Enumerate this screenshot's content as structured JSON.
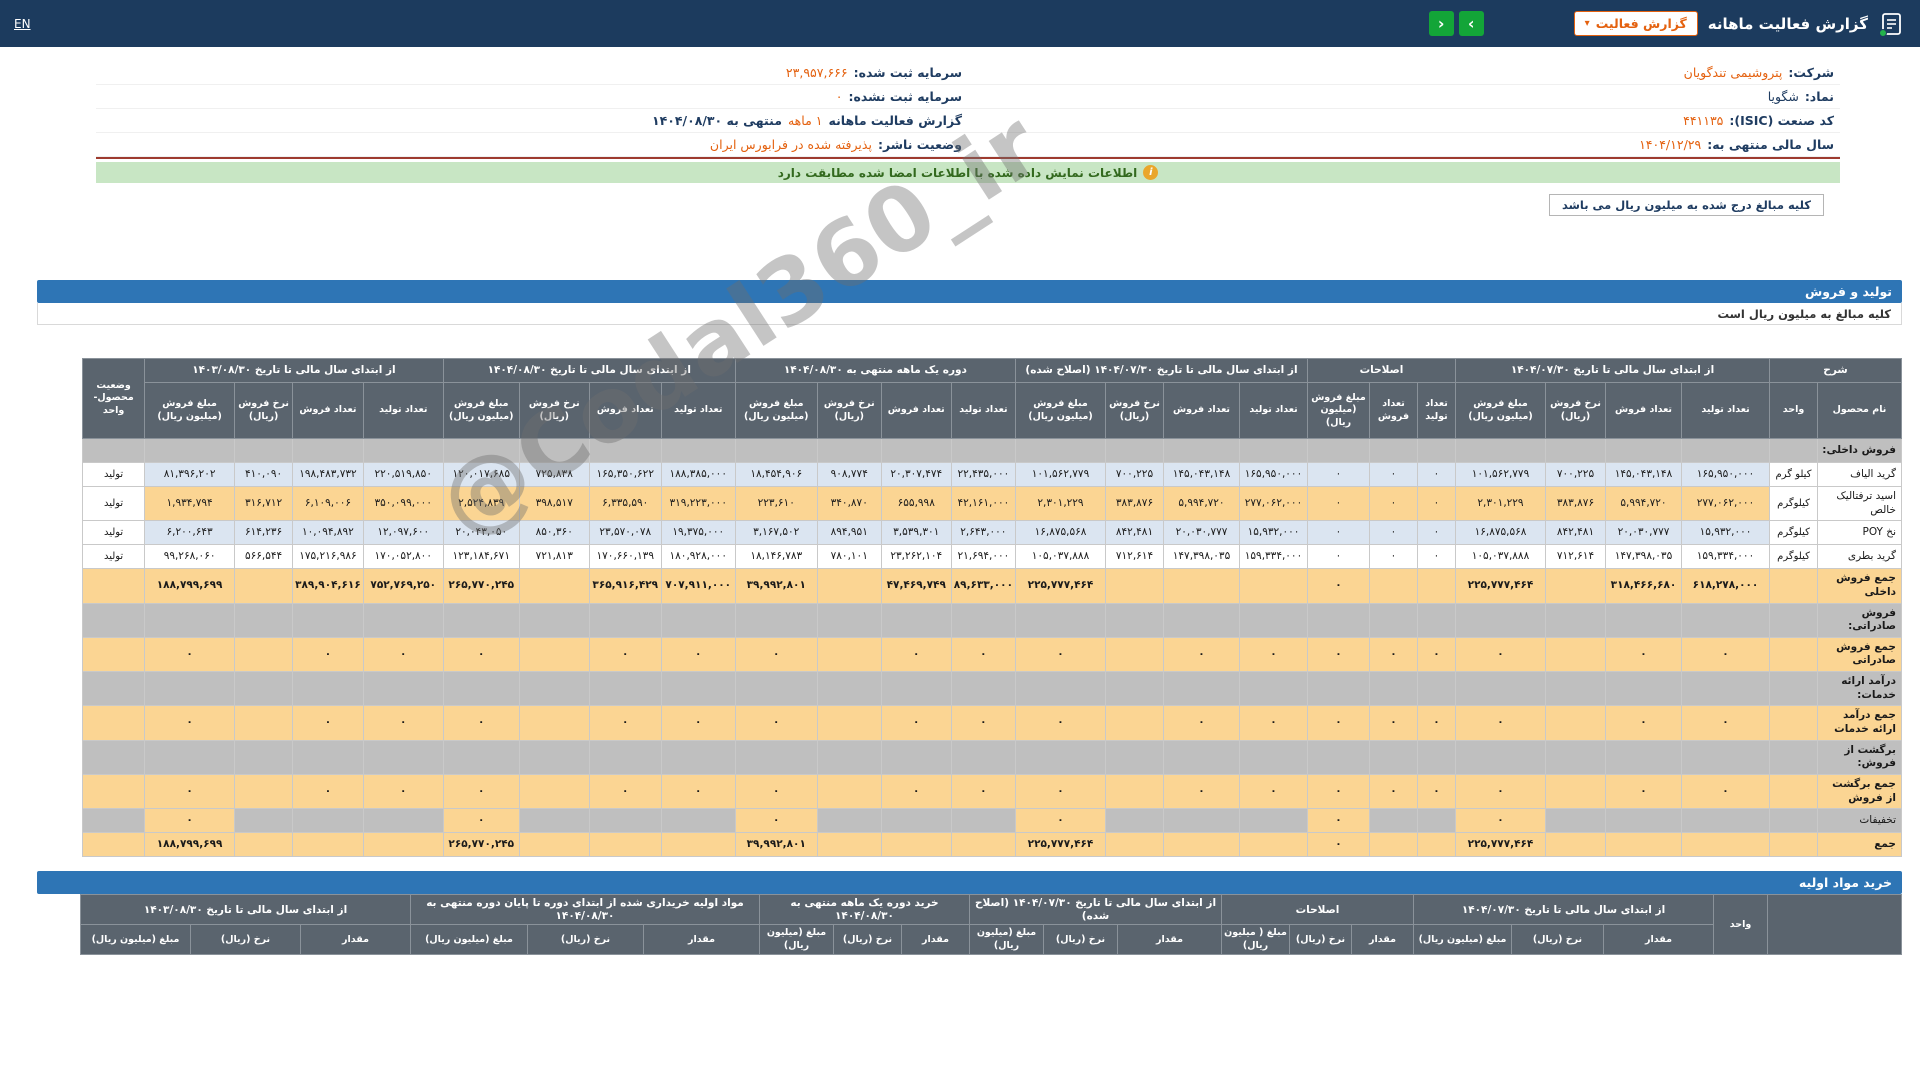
{
  "navbar": {
    "title": "گزارش فعالیت ماهانه",
    "report_button": "گزارش فعالیت",
    "lang_link": "EN"
  },
  "company": {
    "right": [
      {
        "label": "شرکت:",
        "value": "پتروشیمی تندگویان"
      },
      {
        "label": "نماد:",
        "value": "شگویا"
      },
      {
        "label": "کد صنعت (ISIC):",
        "value": "۴۴۱۱۳۵"
      },
      {
        "label": "سال مالی منتهی به:",
        "value": "۱۴۰۴/۱۲/۲۹"
      }
    ],
    "left": [
      {
        "label": "سرمایه ثبت شده:",
        "value": "۲۳,۹۵۷,۶۶۶"
      },
      {
        "label": "سرمایه ثبت نشده:",
        "value": "۰"
      },
      {
        "pre": "گزارش فعالیت ماهانه",
        "mid": "۱ ماهه",
        "post": "منتهی به ۱۴۰۴/۰۸/۳۰"
      },
      {
        "label": "وضعیت ناشر:",
        "value": "پذیرفته شده در فرابورس ایران"
      }
    ]
  },
  "notice": {
    "text": "اطلاعات نمایش داده شده با اطلاعات امضا شده مطابقت دارد"
  },
  "amounts_tab": "کلیه مبالغ درج شده به میلیون ریال می باشد",
  "watermark": "@Codal360_ir",
  "production_sales": {
    "title": "تولید و فروش",
    "note": "کلیه مبالغ به میلیون ریال است",
    "col_groups": [
      {
        "label": "شرح",
        "subs": [
          "نام محصول",
          "واحد"
        ]
      },
      {
        "label": "از ابتدای سال مالی تا تاریخ ۱۴۰۴/۰۷/۳۰",
        "subs": [
          "تعداد تولید",
          "تعداد فروش",
          "نرخ فروش (ریال)",
          "مبلغ فروش (میلیون ریال)"
        ]
      },
      {
        "label": "اصلاحات",
        "subs": [
          "تعداد تولید",
          "تعداد فروش",
          "مبلغ فروش (میلیون ریال)"
        ]
      },
      {
        "label": "از ابتدای سال مالی تا تاریخ ۱۴۰۴/۰۷/۳۰ (اصلاح شده)",
        "subs": [
          "تعداد تولید",
          "تعداد فروش",
          "نرخ فروش (ریال)",
          "مبلغ فروش (میلیون ریال)"
        ]
      },
      {
        "label": "دوره یک ماهه منتهی به ۱۴۰۴/۰۸/۳۰",
        "subs": [
          "تعداد تولید",
          "تعداد فروش",
          "نرخ فروش (ریال)",
          "مبلغ فروش (میلیون ریال)"
        ]
      },
      {
        "label": "از ابتدای سال مالی تا تاریخ ۱۴۰۴/۰۸/۳۰",
        "subs": [
          "تعداد تولید",
          "تعداد فروش",
          "نرخ فروش (ریال)",
          "مبلغ فروش (میلیون ریال)"
        ]
      },
      {
        "label": "از ابتدای سال مالی تا تاریخ ۱۴۰۳/۰۸/۳۰",
        "subs": [
          "تعداد تولید",
          "تعداد فروش",
          "نرخ فروش (ریال)",
          "مبلغ فروش (میلیون ریال)"
        ]
      },
      {
        "label": "وضعیت محصول-واحد",
        "subs": []
      }
    ],
    "rows": [
      {
        "type": "section",
        "name": "فروش داخلی:"
      },
      {
        "type": "data",
        "style": "blue",
        "name": "گرید الیاف",
        "unit": "کیلو گرم",
        "status": "تولید",
        "cells": [
          "۱۶۵,۹۵۰,۰۰۰",
          "۱۴۵,۰۴۳,۱۴۸",
          "۷۰۰,۲۲۵",
          "۱۰۱,۵۶۲,۷۷۹",
          "۰",
          "۰",
          "۰",
          "۱۶۵,۹۵۰,۰۰۰",
          "۱۴۵,۰۴۳,۱۴۸",
          "۷۰۰,۲۲۵",
          "۱۰۱,۵۶۲,۷۷۹",
          "۲۲,۴۳۵,۰۰۰",
          "۲۰,۳۰۷,۴۷۴",
          "۹۰۸,۷۷۴",
          "۱۸,۴۵۴,۹۰۶",
          "۱۸۸,۳۸۵,۰۰۰",
          "۱۶۵,۳۵۰,۶۲۲",
          "۷۲۵,۸۳۸",
          "۱۲۰,۰۱۷,۶۸۵",
          "۲۲۰,۵۱۹,۸۵۰",
          "۱۹۸,۴۸۳,۷۳۲",
          "۴۱۰,۰۹۰",
          "۸۱,۳۹۶,۲۰۲"
        ]
      },
      {
        "type": "data",
        "style": "orange",
        "name": "اسید ترفتالیک خالص",
        "unit": "کیلوگرم",
        "status": "تولید",
        "cells": [
          "۲۷۷,۰۶۲,۰۰۰",
          "۵,۹۹۴,۷۲۰",
          "۳۸۳,۸۷۶",
          "۲,۳۰۱,۲۲۹",
          "۰",
          "۰",
          "۰",
          "۲۷۷,۰۶۲,۰۰۰",
          "۵,۹۹۴,۷۲۰",
          "۳۸۳,۸۷۶",
          "۲,۳۰۱,۲۲۹",
          "۴۲,۱۶۱,۰۰۰",
          "۶۵۵,۹۹۸",
          "۳۴۰,۸۷۰",
          "۲۲۳,۶۱۰",
          "۳۱۹,۲۲۳,۰۰۰",
          "۶,۳۳۵,۵۹۰",
          "۳۹۸,۵۱۷",
          "۲,۵۲۴,۸۳۹",
          "۳۵۰,۰۹۹,۰۰۰",
          "۶,۱۰۹,۰۰۶",
          "۳۱۶,۷۱۲",
          "۱,۹۳۴,۷۹۴"
        ]
      },
      {
        "type": "data",
        "style": "blue",
        "name": "نخ POY",
        "unit": "کیلوگرم",
        "status": "تولید",
        "cells": [
          "۱۵,۹۳۲,۰۰۰",
          "۲۰,۰۳۰,۷۷۷",
          "۸۴۲,۴۸۱",
          "۱۶,۸۷۵,۵۶۸",
          "۰",
          "۰",
          "۰",
          "۱۵,۹۳۲,۰۰۰",
          "۲۰,۰۳۰,۷۷۷",
          "۸۴۲,۴۸۱",
          "۱۶,۸۷۵,۵۶۸",
          "۲,۶۴۳,۰۰۰",
          "۳,۵۳۹,۳۰۱",
          "۸۹۴,۹۵۱",
          "۳,۱۶۷,۵۰۲",
          "۱۹,۳۷۵,۰۰۰",
          "۲۳,۵۷۰,۰۷۸",
          "۸۵۰,۳۶۰",
          "۲۰,۰۴۳,۰۵۰",
          "۱۲,۰۹۷,۶۰۰",
          "۱۰,۰۹۴,۸۹۲",
          "۶۱۴,۲۳۶",
          "۶,۲۰۰,۶۴۳"
        ]
      },
      {
        "type": "data",
        "style": "white",
        "name": "گرید بطری",
        "unit": "کیلوگرم",
        "status": "تولید",
        "cells": [
          "۱۵۹,۳۳۴,۰۰۰",
          "۱۴۷,۳۹۸,۰۳۵",
          "۷۱۲,۶۱۴",
          "۱۰۵,۰۳۷,۸۸۸",
          "۰",
          "۰",
          "۰",
          "۱۵۹,۳۳۴,۰۰۰",
          "۱۴۷,۳۹۸,۰۳۵",
          "۷۱۲,۶۱۴",
          "۱۰۵,۰۳۷,۸۸۸",
          "۲۱,۶۹۴,۰۰۰",
          "۲۳,۲۶۲,۱۰۴",
          "۷۸۰,۱۰۱",
          "۱۸,۱۴۶,۷۸۳",
          "۱۸۰,۹۲۸,۰۰۰",
          "۱۷۰,۶۶۰,۱۳۹",
          "۷۲۱,۸۱۳",
          "۱۲۳,۱۸۴,۶۷۱",
          "۱۷۰,۰۵۲,۸۰۰",
          "۱۷۵,۲۱۶,۹۸۶",
          "۵۶۶,۵۴۴",
          "۹۹,۲۶۸,۰۶۰"
        ]
      },
      {
        "type": "total",
        "name": "جمع فروش داخلی",
        "cells": [
          "۶۱۸,۲۷۸,۰۰۰",
          "۳۱۸,۴۶۶,۶۸۰",
          "",
          "۲۲۵,۷۷۷,۴۶۴",
          "",
          "",
          "۰",
          "",
          "",
          "",
          "۲۲۵,۷۷۷,۴۶۴",
          "۸۹,۶۳۳,۰۰۰",
          "۴۷,۴۶۹,۷۴۹",
          "",
          "۳۹,۹۹۲,۸۰۱",
          "۷۰۷,۹۱۱,۰۰۰",
          "۳۶۵,۹۱۶,۴۲۹",
          "",
          "۲۶۵,۷۷۰,۲۴۵",
          "۷۵۲,۷۶۹,۲۵۰",
          "۳۸۹,۹۰۴,۶۱۶",
          "",
          "۱۸۸,۷۹۹,۶۹۹"
        ]
      },
      {
        "type": "section",
        "name": "فروش صادراتی:"
      },
      {
        "type": "total",
        "name": "جمع فروش صادراتی",
        "cells": [
          "۰",
          "۰",
          "",
          "۰",
          "۰",
          "۰",
          "۰",
          "۰",
          "۰",
          "",
          "۰",
          "۰",
          "۰",
          "",
          "۰",
          "۰",
          "۰",
          "",
          "۰",
          "۰",
          "۰",
          "",
          "۰"
        ]
      },
      {
        "type": "section",
        "name": "درآمد ارائه خدمات:"
      },
      {
        "type": "total",
        "name": "جمع درآمد ارائه خدمات",
        "cells": [
          "۰",
          "۰",
          "",
          "۰",
          "۰",
          "۰",
          "۰",
          "۰",
          "۰",
          "",
          "۰",
          "۰",
          "۰",
          "",
          "۰",
          "۰",
          "۰",
          "",
          "۰",
          "۰",
          "۰",
          "",
          "۰"
        ]
      },
      {
        "type": "section",
        "name": "برگشت از فروش:"
      },
      {
        "type": "total",
        "name": "جمع برگشت از فروش",
        "cells": [
          "۰",
          "۰",
          "",
          "۰",
          "۰",
          "۰",
          "۰",
          "۰",
          "۰",
          "",
          "۰",
          "۰",
          "۰",
          "",
          "۰",
          "۰",
          "۰",
          "",
          "۰",
          "۰",
          "۰",
          "",
          "۰"
        ]
      },
      {
        "type": "discount",
        "name": "تخفیفات",
        "cells": [
          "",
          "",
          "",
          "۰",
          "",
          "",
          "۰",
          "",
          "",
          "",
          "۰",
          "",
          "",
          "",
          "۰",
          "",
          "",
          "",
          "۰",
          "",
          "",
          "",
          "۰"
        ]
      },
      {
        "type": "total",
        "name": "جمع",
        "cells": [
          "",
          "",
          "",
          "۲۲۵,۷۷۷,۴۶۴",
          "",
          "",
          "۰",
          "",
          "",
          "",
          "۲۲۵,۷۷۷,۴۶۴",
          "",
          "",
          "",
          "۳۹,۹۹۲,۸۰۱",
          "",
          "",
          "",
          "۲۶۵,۷۷۰,۲۴۵",
          "",
          "",
          "",
          "۱۸۸,۷۹۹,۶۹۹"
        ]
      }
    ]
  },
  "raw_materials": {
    "title": "خرید مواد اولیه",
    "col_groups": [
      {
        "label": "",
        "subs": []
      },
      {
        "label": "واحد",
        "subs": []
      },
      {
        "label": "از ابتدای سال مالی تا تاریخ ۱۴۰۴/۰۷/۳۰",
        "subs": [
          "مقدار",
          "نرخ (ریال)",
          "مبلغ (میلیون ریال)"
        ]
      },
      {
        "label": "اصلاحات",
        "subs": [
          "مقدار",
          "نرخ (ریال)",
          "مبلغ ( میلیون ریال)"
        ]
      },
      {
        "label": "از ابتدای سال مالی تا تاریخ ۱۴۰۴/۰۷/۳۰ (اصلاح شده)",
        "subs": [
          "مقدار",
          "نرخ (ریال)",
          "مبلغ (میلیون ریال)"
        ]
      },
      {
        "label": "خرید دوره یک ماهه منتهی به ۱۴۰۴/۰۸/۳۰",
        "subs": [
          "مقدار",
          "نرخ (ریال)",
          "مبلغ (میلیون ریال)"
        ]
      },
      {
        "label": "مواد اولیه خریداری شده از ابتدای دوره تا پایان دوره منتهی به ۱۴۰۴/۰۸/۳۰",
        "subs": [
          "مقدار",
          "نرخ (ریال)",
          "مبلغ (میلیون ریال)"
        ]
      },
      {
        "label": "از ابتدای سال مالی تا تاریخ ۱۴۰۳/۰۸/۳۰",
        "subs": [
          "مقدار",
          "نرخ (ریال)",
          "مبلغ (میلیون ریال)"
        ]
      }
    ]
  }
}
